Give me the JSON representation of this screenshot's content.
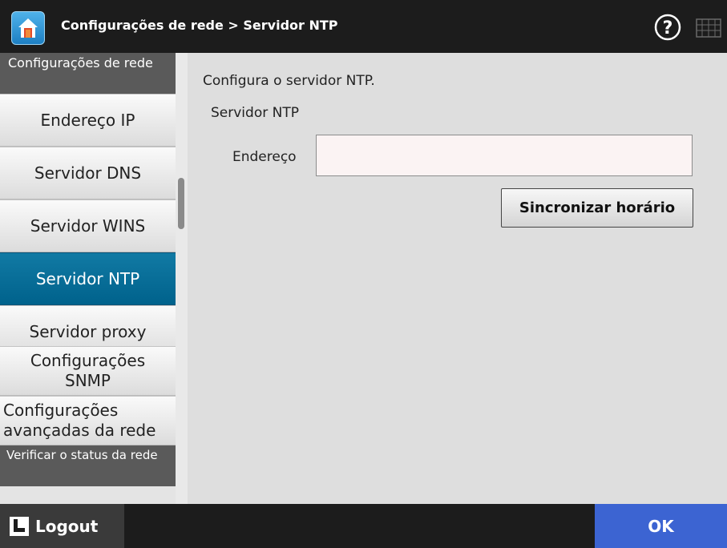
{
  "header": {
    "title": "Configurações de rede > Servidor NTP"
  },
  "sidebar": {
    "section_network": "Configurações de rede",
    "items": [
      {
        "label": "Endereço IP"
      },
      {
        "label": "Servidor DNS"
      },
      {
        "label": "Servidor WINS"
      },
      {
        "label": "Servidor NTP",
        "active": true
      },
      {
        "label": "Servidor proxy"
      },
      {
        "label": "Configurações SNMP"
      },
      {
        "label": "Configurações avançadas da rede"
      }
    ],
    "section_status": "Verificar o status da rede"
  },
  "main": {
    "description": "Configura o servidor NTP.",
    "section_title": "Servidor NTP",
    "address_label": "Endereço",
    "address_value": "",
    "sync_button": "Sincronizar horário"
  },
  "footer": {
    "logout_label": "Logout",
    "ok_label": "OK"
  },
  "colors": {
    "active_item": "#0a6f9a",
    "ok_button": "#3c64d2",
    "home_button": "#2f97d8"
  },
  "icons": {
    "home": "home-icon",
    "help": "help-icon",
    "keyboard": "keyboard-icon",
    "logout": "logout-icon"
  }
}
